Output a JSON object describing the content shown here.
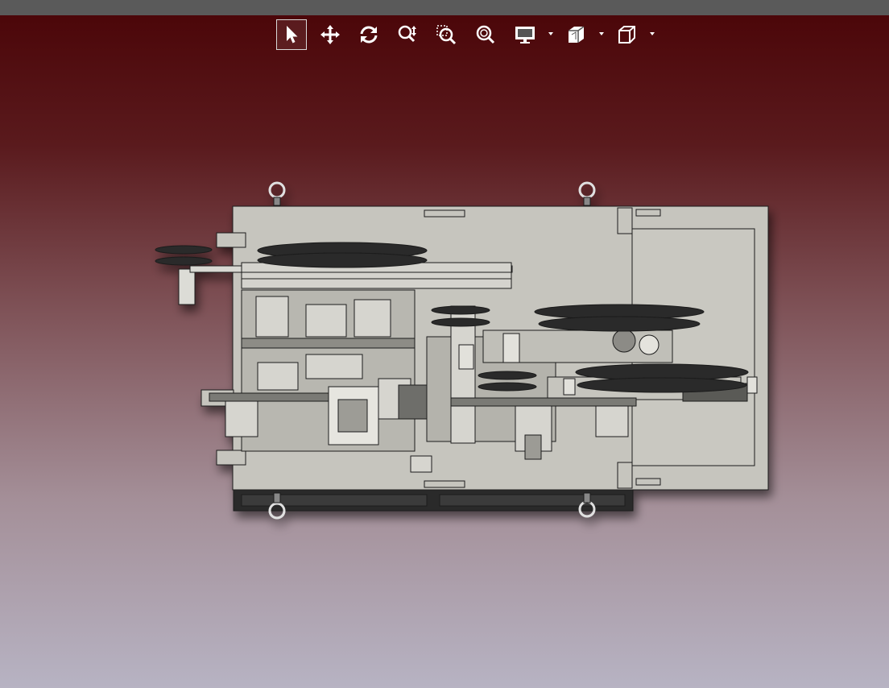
{
  "window": {
    "topbar_color": "#5a5a5a"
  },
  "toolbar": {
    "items": [
      {
        "name": "select-tool",
        "icon": "cursor-arrow-icon",
        "active": true
      },
      {
        "name": "pan-tool",
        "icon": "move-arrows-icon",
        "active": false
      },
      {
        "name": "rotate-tool",
        "icon": "rotate-icon",
        "active": false
      },
      {
        "name": "zoom-tool",
        "icon": "zoom-updown-icon",
        "active": false
      },
      {
        "name": "zoom-window-tool",
        "icon": "zoom-window-icon",
        "active": false
      },
      {
        "name": "zoom-fit-tool",
        "icon": "zoom-fit-icon",
        "active": false
      },
      {
        "name": "display-menu",
        "icon": "monitor-icon",
        "has_dropdown": true
      },
      {
        "name": "section-menu",
        "icon": "section-cube-icon",
        "has_dropdown": true
      },
      {
        "name": "view-orientation-menu",
        "icon": "cube-icon",
        "has_dropdown": true
      }
    ]
  },
  "viewport": {
    "background_top": "#4a0407",
    "background_bottom": "#b7b3c3",
    "model_color": "#c6c5be",
    "model_edge_color": "#1a1a1a"
  }
}
